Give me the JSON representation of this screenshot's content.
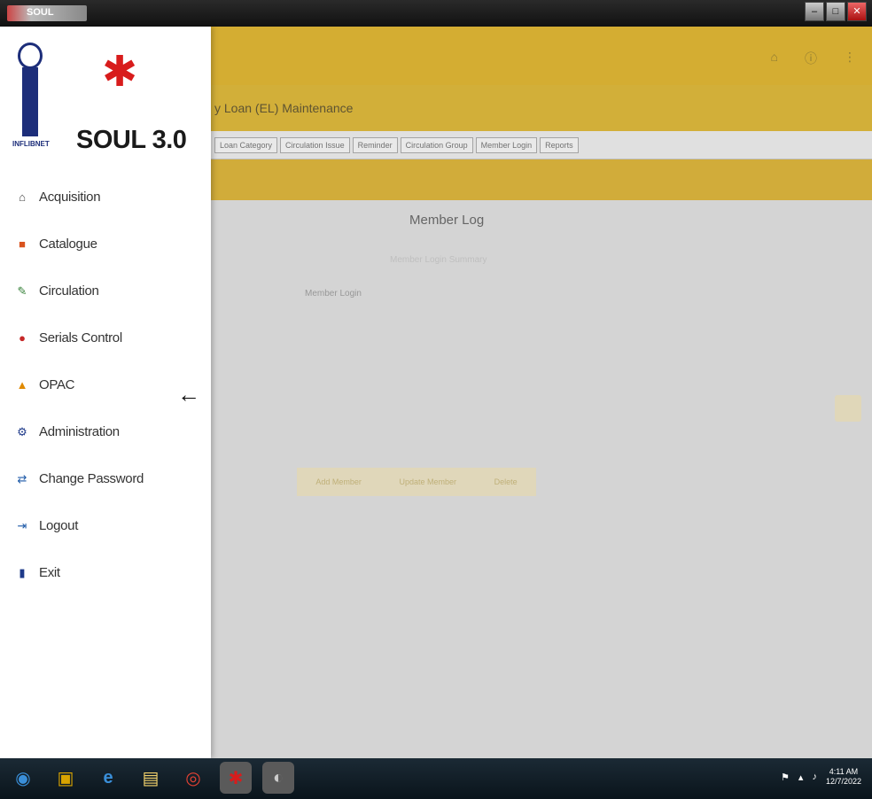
{
  "window": {
    "title": "SOUL",
    "controls": [
      "–",
      "□",
      "✕"
    ]
  },
  "app": {
    "breadcrumb": "y Loan  (EL)   Maintenance",
    "tabs": [
      "Loan Category",
      "Circulation Issue",
      "Reminder",
      "Circulation Group",
      "Member Login",
      "Reports"
    ],
    "content": {
      "heading": "Member Log",
      "subheading": "Member Login Summary",
      "field_label": "Member Login",
      "buttons": [
        "Add Member",
        "Update Member",
        "Delete"
      ]
    }
  },
  "drawer": {
    "logo_caption": "INFLIBNET",
    "product_title": "SOUL 3.0",
    "collapse_icon": "arrow-left-icon",
    "menu": [
      {
        "label": "Acquisition",
        "icon": "acquisition-icon",
        "color": "#444444",
        "glyph": "⌂"
      },
      {
        "label": "Catalogue",
        "icon": "catalogue-icon",
        "color": "#d9531e",
        "glyph": "■"
      },
      {
        "label": "Circulation",
        "icon": "circulation-icon",
        "color": "#2f7d32",
        "glyph": "✎"
      },
      {
        "label": "Serials Control",
        "icon": "serials-icon",
        "color": "#c62828",
        "glyph": "●"
      },
      {
        "label": "OPAC",
        "icon": "opac-icon",
        "color": "#e08a00",
        "glyph": "▲"
      },
      {
        "label": "Administration",
        "icon": "administration-icon",
        "color": "#1e3a8a",
        "glyph": "⚙"
      },
      {
        "label": "Change Password",
        "icon": "change-password-icon",
        "color": "#1e5aa8",
        "glyph": "⇄"
      },
      {
        "label": "Logout",
        "icon": "logout-icon",
        "color": "#1e5aa8",
        "glyph": "⇥"
      },
      {
        "label": "Exit",
        "icon": "exit-icon",
        "color": "#1e3a8a",
        "glyph": "▮"
      }
    ]
  },
  "taskbar": {
    "apps": [
      {
        "name": "start-button",
        "glyph": "◉",
        "color": "#3a8fd9"
      },
      {
        "name": "app-icon",
        "glyph": "▣",
        "color": "#d9a400"
      },
      {
        "name": "ie-icon",
        "glyph": "e",
        "color": "#3a8fd9"
      },
      {
        "name": "explorer-icon",
        "glyph": "▤",
        "color": "#f2d16b"
      },
      {
        "name": "chrome-icon",
        "glyph": "◎",
        "color": "#e34133"
      },
      {
        "name": "soul-app-icon",
        "glyph": "✱",
        "color": "#d81c1c"
      },
      {
        "name": "media-icon",
        "glyph": "◐",
        "color": "#cccccc"
      }
    ],
    "tray_clock": "4:11 AM\n12/7/2022"
  }
}
